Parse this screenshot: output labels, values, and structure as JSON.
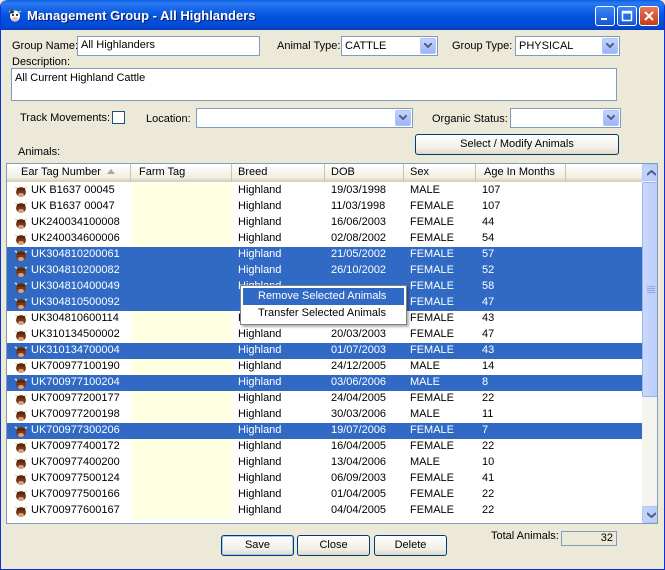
{
  "window": {
    "title": "Management Group - All Highlanders",
    "icon": "cow-icon"
  },
  "form": {
    "group_name_label": "Group Name:",
    "group_name_value": "All Highlanders",
    "animal_type_label": "Animal Type:",
    "animal_type_value": "CATTLE",
    "group_type_label": "Group Type:",
    "group_type_value": "PHYSICAL",
    "description_label": "Description:",
    "description_value": "All Current Highland Cattle",
    "track_movements_label": "Track Movements:",
    "track_movements_checked": false,
    "location_label": "Location:",
    "location_value": "",
    "organic_status_label": "Organic Status:",
    "organic_status_value": "",
    "select_modify_label": "Select / Modify Animals",
    "animals_label": "Animals:"
  },
  "grid": {
    "columns": [
      "Ear Tag Number",
      "Farm Tag",
      "Breed",
      "DOB",
      "Sex",
      "Age In Months"
    ],
    "rows": [
      {
        "tag": "UK B1637 00045",
        "farm": "",
        "breed": "Highland",
        "dob": "19/03/1998",
        "sex": "MALE",
        "age": "107",
        "selected": false
      },
      {
        "tag": "UK B1637 00047",
        "farm": "",
        "breed": "Highland",
        "dob": "11/03/1998",
        "sex": "FEMALE",
        "age": "107",
        "selected": false
      },
      {
        "tag": "UK240034100008",
        "farm": "",
        "breed": "Highland",
        "dob": "16/06/2003",
        "sex": "FEMALE",
        "age": "44",
        "selected": false
      },
      {
        "tag": "UK240034600006",
        "farm": "",
        "breed": "Highland",
        "dob": "02/08/2002",
        "sex": "FEMALE",
        "age": "54",
        "selected": false
      },
      {
        "tag": "UK304810200061",
        "farm": "",
        "breed": "Highland",
        "dob": "21/05/2002",
        "sex": "FEMALE",
        "age": "57",
        "selected": true
      },
      {
        "tag": "UK304810200082",
        "farm": "",
        "breed": "Highland",
        "dob": "26/10/2002",
        "sex": "FEMALE",
        "age": "52",
        "selected": true
      },
      {
        "tag": "UK304810400049",
        "farm": "",
        "breed": "Highland",
        "dob": "",
        "sex": "FEMALE",
        "age": "58",
        "selected": true
      },
      {
        "tag": "UK304810500092",
        "farm": "",
        "breed": "",
        "dob": "",
        "sex": "FEMALE",
        "age": "47",
        "selected": true
      },
      {
        "tag": "UK304810600114",
        "farm": "",
        "breed": "H",
        "dob": "",
        "sex": "FEMALE",
        "age": "43",
        "selected": false
      },
      {
        "tag": "UK310134500002",
        "farm": "",
        "breed": "Highland",
        "dob": "20/03/2003",
        "sex": "FEMALE",
        "age": "47",
        "selected": false
      },
      {
        "tag": "UK310134700004",
        "farm": "",
        "breed": "Highland",
        "dob": "01/07/2003",
        "sex": "FEMALE",
        "age": "43",
        "selected": true
      },
      {
        "tag": "UK700977100190",
        "farm": "",
        "breed": "Highland",
        "dob": "24/12/2005",
        "sex": "MALE",
        "age": "14",
        "selected": false
      },
      {
        "tag": "UK700977100204",
        "farm": "",
        "breed": "Highland",
        "dob": "03/06/2006",
        "sex": "MALE",
        "age": "8",
        "selected": true
      },
      {
        "tag": "UK700977200177",
        "farm": "",
        "breed": "Highland",
        "dob": "24/04/2005",
        "sex": "FEMALE",
        "age": "22",
        "selected": false
      },
      {
        "tag": "UK700977200198",
        "farm": "",
        "breed": "Highland",
        "dob": "30/03/2006",
        "sex": "MALE",
        "age": "11",
        "selected": false
      },
      {
        "tag": "UK700977300206",
        "farm": "",
        "breed": "Highland",
        "dob": "19/07/2006",
        "sex": "FEMALE",
        "age": "7",
        "selected": true
      },
      {
        "tag": "UK700977400172",
        "farm": "",
        "breed": "Highland",
        "dob": "16/04/2005",
        "sex": "FEMALE",
        "age": "22",
        "selected": false
      },
      {
        "tag": "UK700977400200",
        "farm": "",
        "breed": "Highland",
        "dob": "13/04/2006",
        "sex": "MALE",
        "age": "10",
        "selected": false
      },
      {
        "tag": "UK700977500124",
        "farm": "",
        "breed": "Highland",
        "dob": "06/09/2003",
        "sex": "FEMALE",
        "age": "41",
        "selected": false
      },
      {
        "tag": "UK700977500166",
        "farm": "",
        "breed": "Highland",
        "dob": "01/04/2005",
        "sex": "FEMALE",
        "age": "22",
        "selected": false
      },
      {
        "tag": "UK700977600167",
        "farm": "",
        "breed": "Highland",
        "dob": "04/04/2005",
        "sex": "FEMALE",
        "age": "22",
        "selected": false
      }
    ]
  },
  "context_menu": {
    "items": [
      "Remove Selected Animals",
      "Transfer Selected Animals"
    ]
  },
  "buttons": {
    "save": "Save",
    "close": "Close",
    "delete": "Delete"
  },
  "footer": {
    "total_label": "Total Animals:",
    "total_value": "32"
  },
  "colors": {
    "selection": "#316ac5",
    "zebra": "#ffffe1",
    "titlebar": "#0555e0"
  }
}
